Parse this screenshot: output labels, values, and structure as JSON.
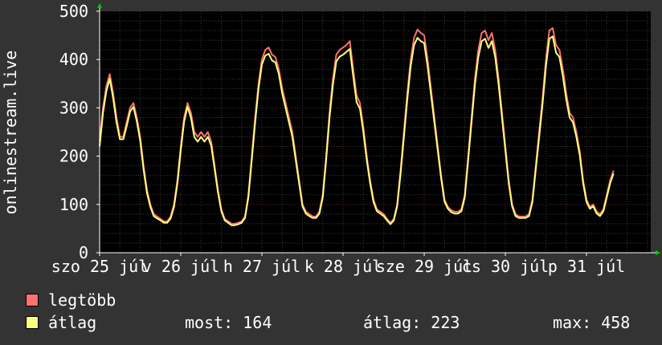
{
  "colors": {
    "background": "#333333",
    "plot_background": "#000000",
    "grid": "#5a2a2a",
    "grid_minor": "#3a3a3a",
    "axis_arrow": "#00cc00",
    "legtobb": "#ff7070",
    "atlag": "#ffff80"
  },
  "chart_data": {
    "type": "line",
    "ylabel": "onlinestream.live",
    "ylim": [
      0,
      500
    ],
    "yticks": [
      0,
      100,
      200,
      300,
      400,
      500
    ],
    "xlim": [
      0,
      163
    ],
    "x_unit": "hours since szo 25 júl 00:00",
    "xticks": [
      {
        "label": "szo 25 júl",
        "x": 0
      },
      {
        "label": "v 26 júl",
        "x": 24
      },
      {
        "label": "h 27 júl",
        "x": 48
      },
      {
        "label": "k 28 júl",
        "x": 72
      },
      {
        "label": "sze 29 júl",
        "x": 96
      },
      {
        "label": "cs 30 júl",
        "x": 120
      },
      {
        "label": "p 31 júl",
        "x": 144
      }
    ],
    "grid": true,
    "legend_placement": "bottom-left",
    "series": [
      {
        "name": "legtöbb",
        "color": "#ff7070",
        "points": [
          [
            0,
            230
          ],
          [
            1,
            300
          ],
          [
            2,
            345
          ],
          [
            3,
            370
          ],
          [
            4,
            330
          ],
          [
            5,
            280
          ],
          [
            6,
            240
          ],
          [
            7,
            240
          ],
          [
            8,
            270
          ],
          [
            9,
            300
          ],
          [
            10,
            310
          ],
          [
            11,
            280
          ],
          [
            12,
            240
          ],
          [
            13,
            180
          ],
          [
            14,
            130
          ],
          [
            15,
            100
          ],
          [
            16,
            80
          ],
          [
            17,
            75
          ],
          [
            18,
            70
          ],
          [
            19,
            65
          ],
          [
            20,
            65
          ],
          [
            21,
            75
          ],
          [
            22,
            100
          ],
          [
            23,
            150
          ],
          [
            24,
            220
          ],
          [
            25,
            280
          ],
          [
            26,
            310
          ],
          [
            27,
            290
          ],
          [
            28,
            250
          ],
          [
            29,
            240
          ],
          [
            30,
            250
          ],
          [
            31,
            240
          ],
          [
            32,
            250
          ],
          [
            33,
            230
          ],
          [
            34,
            180
          ],
          [
            35,
            130
          ],
          [
            36,
            90
          ],
          [
            37,
            70
          ],
          [
            38,
            65
          ],
          [
            39,
            60
          ],
          [
            40,
            60
          ],
          [
            41,
            62
          ],
          [
            42,
            65
          ],
          [
            43,
            75
          ],
          [
            44,
            120
          ],
          [
            45,
            200
          ],
          [
            46,
            280
          ],
          [
            47,
            350
          ],
          [
            48,
            400
          ],
          [
            49,
            420
          ],
          [
            50,
            425
          ],
          [
            51,
            410
          ],
          [
            52,
            405
          ],
          [
            53,
            380
          ],
          [
            54,
            340
          ],
          [
            55,
            310
          ],
          [
            56,
            280
          ],
          [
            57,
            250
          ],
          [
            58,
            200
          ],
          [
            59,
            150
          ],
          [
            60,
            100
          ],
          [
            61,
            85
          ],
          [
            62,
            80
          ],
          [
            63,
            75
          ],
          [
            64,
            75
          ],
          [
            65,
            85
          ],
          [
            66,
            120
          ],
          [
            67,
            200
          ],
          [
            68,
            290
          ],
          [
            69,
            360
          ],
          [
            70,
            410
          ],
          [
            71,
            420
          ],
          [
            72,
            425
          ],
          [
            73,
            430
          ],
          [
            74,
            438
          ],
          [
            75,
            380
          ],
          [
            76,
            325
          ],
          [
            77,
            310
          ],
          [
            78,
            260
          ],
          [
            79,
            200
          ],
          [
            80,
            150
          ],
          [
            81,
            110
          ],
          [
            82,
            90
          ],
          [
            83,
            85
          ],
          [
            84,
            80
          ],
          [
            85,
            70
          ],
          [
            86,
            62
          ],
          [
            87,
            70
          ],
          [
            88,
            100
          ],
          [
            89,
            170
          ],
          [
            90,
            250
          ],
          [
            91,
            330
          ],
          [
            92,
            400
          ],
          [
            93,
            445
          ],
          [
            94,
            462
          ],
          [
            95,
            455
          ],
          [
            96,
            450
          ],
          [
            97,
            400
          ],
          [
            98,
            340
          ],
          [
            99,
            280
          ],
          [
            100,
            220
          ],
          [
            101,
            160
          ],
          [
            102,
            110
          ],
          [
            103,
            95
          ],
          [
            104,
            88
          ],
          [
            105,
            85
          ],
          [
            106,
            85
          ],
          [
            107,
            90
          ],
          [
            108,
            120
          ],
          [
            109,
            200
          ],
          [
            110,
            280
          ],
          [
            111,
            360
          ],
          [
            112,
            420
          ],
          [
            113,
            455
          ],
          [
            114,
            460
          ],
          [
            115,
            440
          ],
          [
            116,
            455
          ],
          [
            117,
            420
          ],
          [
            118,
            360
          ],
          [
            119,
            290
          ],
          [
            120,
            220
          ],
          [
            121,
            150
          ],
          [
            122,
            100
          ],
          [
            123,
            80
          ],
          [
            124,
            75
          ],
          [
            125,
            75
          ],
          [
            126,
            75
          ],
          [
            127,
            80
          ],
          [
            128,
            110
          ],
          [
            129,
            180
          ],
          [
            130,
            250
          ],
          [
            131,
            320
          ],
          [
            132,
            400
          ],
          [
            133,
            460
          ],
          [
            134,
            465
          ],
          [
            135,
            430
          ],
          [
            136,
            420
          ],
          [
            137,
            380
          ],
          [
            138,
            330
          ],
          [
            139,
            290
          ],
          [
            140,
            280
          ],
          [
            141,
            250
          ],
          [
            142,
            210
          ],
          [
            143,
            150
          ],
          [
            144,
            110
          ],
          [
            145,
            95
          ],
          [
            146,
            100
          ],
          [
            147,
            85
          ],
          [
            148,
            80
          ],
          [
            149,
            90
          ],
          [
            150,
            120
          ],
          [
            151,
            150
          ],
          [
            152,
            170
          ]
        ]
      },
      {
        "name": "átlag",
        "color": "#ffff80",
        "points": [
          [
            0,
            220
          ],
          [
            1,
            290
          ],
          [
            2,
            335
          ],
          [
            3,
            360
          ],
          [
            4,
            320
          ],
          [
            5,
            270
          ],
          [
            6,
            235
          ],
          [
            7,
            235
          ],
          [
            8,
            262
          ],
          [
            9,
            292
          ],
          [
            10,
            302
          ],
          [
            11,
            272
          ],
          [
            12,
            232
          ],
          [
            13,
            172
          ],
          [
            14,
            124
          ],
          [
            15,
            95
          ],
          [
            16,
            76
          ],
          [
            17,
            71
          ],
          [
            18,
            67
          ],
          [
            19,
            62
          ],
          [
            20,
            62
          ],
          [
            21,
            71
          ],
          [
            22,
            95
          ],
          [
            23,
            143
          ],
          [
            24,
            212
          ],
          [
            25,
            272
          ],
          [
            26,
            302
          ],
          [
            27,
            280
          ],
          [
            28,
            240
          ],
          [
            29,
            230
          ],
          [
            30,
            240
          ],
          [
            31,
            230
          ],
          [
            32,
            240
          ],
          [
            33,
            222
          ],
          [
            34,
            174
          ],
          [
            35,
            125
          ],
          [
            36,
            86
          ],
          [
            37,
            67
          ],
          [
            38,
            62
          ],
          [
            39,
            57
          ],
          [
            40,
            57
          ],
          [
            41,
            59
          ],
          [
            42,
            62
          ],
          [
            43,
            72
          ],
          [
            44,
            115
          ],
          [
            45,
            192
          ],
          [
            46,
            270
          ],
          [
            47,
            340
          ],
          [
            48,
            390
          ],
          [
            49,
            408
          ],
          [
            50,
            412
          ],
          [
            51,
            398
          ],
          [
            52,
            394
          ],
          [
            53,
            370
          ],
          [
            54,
            330
          ],
          [
            55,
            300
          ],
          [
            56,
            270
          ],
          [
            57,
            240
          ],
          [
            58,
            192
          ],
          [
            59,
            144
          ],
          [
            60,
            96
          ],
          [
            61,
            81
          ],
          [
            62,
            76
          ],
          [
            63,
            72
          ],
          [
            64,
            72
          ],
          [
            65,
            81
          ],
          [
            66,
            115
          ],
          [
            67,
            192
          ],
          [
            68,
            280
          ],
          [
            69,
            348
          ],
          [
            70,
            396
          ],
          [
            71,
            406
          ],
          [
            72,
            410
          ],
          [
            73,
            416
          ],
          [
            74,
            422
          ],
          [
            75,
            366
          ],
          [
            76,
            312
          ],
          [
            77,
            298
          ],
          [
            78,
            250
          ],
          [
            79,
            192
          ],
          [
            80,
            144
          ],
          [
            81,
            105
          ],
          [
            82,
            86
          ],
          [
            83,
            81
          ],
          [
            84,
            76
          ],
          [
            85,
            67
          ],
          [
            86,
            59
          ],
          [
            87,
            67
          ],
          [
            88,
            96
          ],
          [
            89,
            163
          ],
          [
            90,
            240
          ],
          [
            91,
            318
          ],
          [
            92,
            386
          ],
          [
            93,
            430
          ],
          [
            94,
            445
          ],
          [
            95,
            438
          ],
          [
            96,
            434
          ],
          [
            97,
            386
          ],
          [
            98,
            328
          ],
          [
            99,
            270
          ],
          [
            100,
            212
          ],
          [
            101,
            154
          ],
          [
            102,
            106
          ],
          [
            103,
            91
          ],
          [
            104,
            84
          ],
          [
            105,
            81
          ],
          [
            106,
            81
          ],
          [
            107,
            86
          ],
          [
            108,
            115
          ],
          [
            109,
            192
          ],
          [
            110,
            270
          ],
          [
            111,
            348
          ],
          [
            112,
            405
          ],
          [
            113,
            438
          ],
          [
            114,
            443
          ],
          [
            115,
            424
          ],
          [
            116,
            438
          ],
          [
            117,
            405
          ],
          [
            118,
            348
          ],
          [
            119,
            280
          ],
          [
            120,
            212
          ],
          [
            121,
            144
          ],
          [
            122,
            96
          ],
          [
            123,
            76
          ],
          [
            124,
            72
          ],
          [
            125,
            72
          ],
          [
            126,
            72
          ],
          [
            127,
            76
          ],
          [
            128,
            105
          ],
          [
            129,
            173
          ],
          [
            130,
            240
          ],
          [
            131,
            308
          ],
          [
            132,
            386
          ],
          [
            133,
            443
          ],
          [
            134,
            448
          ],
          [
            135,
            414
          ],
          [
            136,
            405
          ],
          [
            137,
            366
          ],
          [
            138,
            318
          ],
          [
            139,
            280
          ],
          [
            140,
            270
          ],
          [
            141,
            240
          ],
          [
            142,
            202
          ],
          [
            143,
            144
          ],
          [
            144,
            105
          ],
          [
            145,
            91
          ],
          [
            146,
            96
          ],
          [
            147,
            81
          ],
          [
            148,
            76
          ],
          [
            149,
            86
          ],
          [
            150,
            115
          ],
          [
            151,
            144
          ],
          [
            152,
            164
          ]
        ]
      }
    ],
    "legend": [
      {
        "label": "legtöbb",
        "color": "#ff7070"
      },
      {
        "label": "átlag",
        "color": "#ffff80"
      }
    ],
    "stats": {
      "most": "most: 164",
      "atlag": "átlag: 223",
      "max": "max: 458"
    }
  }
}
